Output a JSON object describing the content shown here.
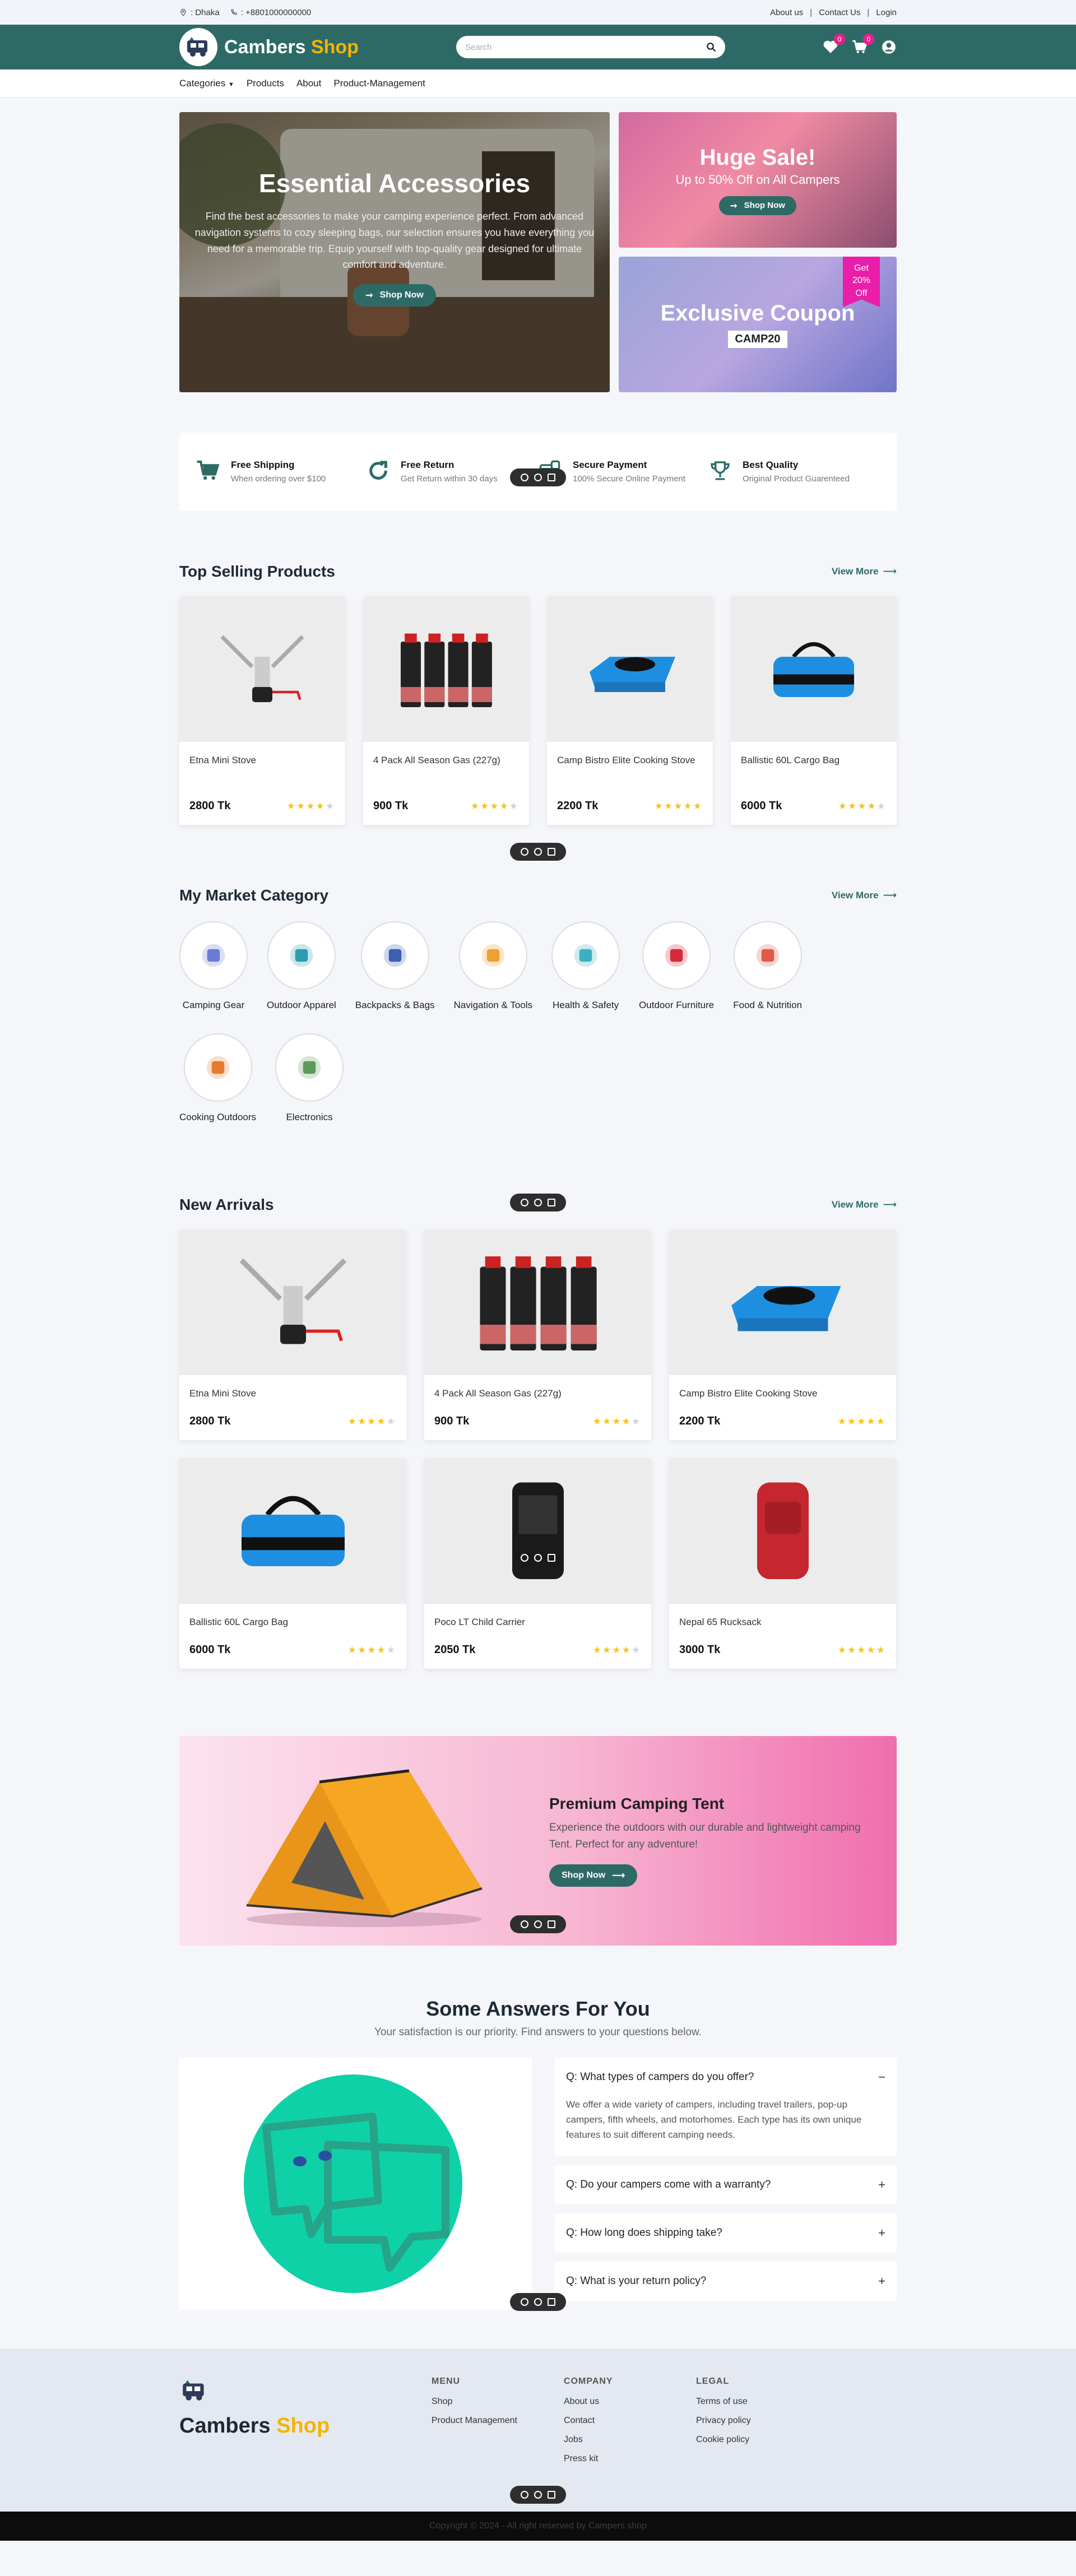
{
  "topbar": {
    "location": ": Dhaka",
    "phone": ": +8801000000000",
    "links": [
      "About us",
      "Contact Us",
      "Login"
    ]
  },
  "header": {
    "brand_first": "Cambers",
    "brand_second": "Shop",
    "search_placeholder": "Search",
    "wishlist_count": "0",
    "cart_count": "0"
  },
  "nav": {
    "items": [
      "Categories",
      "Products",
      "About",
      "Product-Management"
    ]
  },
  "hero": {
    "title": "Essential Accessories",
    "description": "Find the best accessories to make your camping experience perfect. From advanced navigation systems to cozy sleeping bags, our selection ensures you have everything you need for a memorable trip. Equip yourself with top-quality gear designed for ultimate comfort and adventure.",
    "button": "Shop Now"
  },
  "promos": {
    "sale_title": "Huge Sale!",
    "sale_sub": "Up to 50% Off on All Campers",
    "sale_button": "Shop Now",
    "coupon_title": "Exclusive Coupon",
    "coupon_code": "CAMP20",
    "badge_1": "Get",
    "badge_2": "20%",
    "badge_3": "Off"
  },
  "features": [
    {
      "title": "Free Shipping",
      "desc": "When ordering over $100",
      "icon": "cart-icon"
    },
    {
      "title": "Free Return",
      "desc": "Get Return within 30 days",
      "icon": "refresh-icon"
    },
    {
      "title": "Secure Payment",
      "desc": "100% Secure Online Payment",
      "icon": "payment-icon"
    },
    {
      "title": "Best Quality",
      "desc": "Original Product Guarenteed",
      "icon": "trophy-icon"
    }
  ],
  "top_selling": {
    "title": "Top Selling Products",
    "view_more": "View More",
    "products": [
      {
        "name": "Etna Mini Stove",
        "price": "2800 Tk",
        "rating": 4
      },
      {
        "name": "4 Pack All Season Gas (227g)",
        "price": "900 Tk",
        "rating": 4
      },
      {
        "name": "Camp Bistro Elite Cooking Stove",
        "price": "2200 Tk",
        "rating": 5
      },
      {
        "name": "Ballistic 60L Cargo Bag",
        "price": "6000 Tk",
        "rating": 4
      }
    ]
  },
  "categories": {
    "title": "My Market Category",
    "view_more": "View More",
    "items": [
      "Camping Gear",
      "Outdoor Apparel",
      "Backpacks & Bags",
      "Navigation & Tools",
      "Health & Safety",
      "Outdoor Furniture",
      "Food & Nutrition",
      "Cooking Outdoors",
      "Electronics"
    ]
  },
  "new_arrivals": {
    "title": "New Arrivals",
    "view_more": "View More",
    "products": [
      {
        "name": "Etna Mini Stove",
        "price": "2800 Tk",
        "rating": 4
      },
      {
        "name": "4 Pack All Season Gas (227g)",
        "price": "900 Tk",
        "rating": 4
      },
      {
        "name": "Camp Bistro Elite Cooking Stove",
        "price": "2200 Tk",
        "rating": 5
      },
      {
        "name": "Ballistic 60L Cargo Bag",
        "price": "6000 Tk",
        "rating": 4
      },
      {
        "name": "Poco LT Child Carrier",
        "price": "2050 Tk",
        "rating": 4
      },
      {
        "name": "Nepal 65 Rucksack",
        "price": "3000 Tk",
        "rating": 5
      }
    ]
  },
  "tent_banner": {
    "title": "Premium Camping Tent",
    "desc": "Experience the outdoors with our durable and lightweight camping Tent. Perfect for any adventure!",
    "button": "Shop Now"
  },
  "faq": {
    "title": "Some Answers For You",
    "subtitle": "Your satisfaction is our priority. Find answers to your questions below.",
    "items": [
      {
        "q": "Q: What types of campers do you offer?",
        "a": "We offer a wide variety of campers, including travel trailers, pop-up campers, fifth wheels, and motorhomes. Each type has its own unique features to suit different camping needs.",
        "toggle": "−"
      },
      {
        "q": "Q: Do your campers come with a warranty?",
        "toggle": "+"
      },
      {
        "q": "Q: How long does shipping take?",
        "toggle": "+"
      },
      {
        "q": "Q: What is your return policy?",
        "toggle": "+"
      }
    ]
  },
  "footer": {
    "brand_first": "Cambers",
    "brand_second": "Shop",
    "menu_title": "MENU",
    "menu": [
      "Shop",
      "Product Management"
    ],
    "company_title": "COMPANY",
    "company": [
      "About us",
      "Contact",
      "Jobs",
      "Press kit"
    ],
    "legal_title": "LEGAL",
    "legal": [
      "Terms of use",
      "Privacy policy",
      "Cookie policy"
    ],
    "copyright": "Copyright © 2024 - All right reserved by Campers shop"
  },
  "colors": {
    "primary": "#2d6a66",
    "accent": "#f4b400",
    "badge": "#e91e8c"
  }
}
